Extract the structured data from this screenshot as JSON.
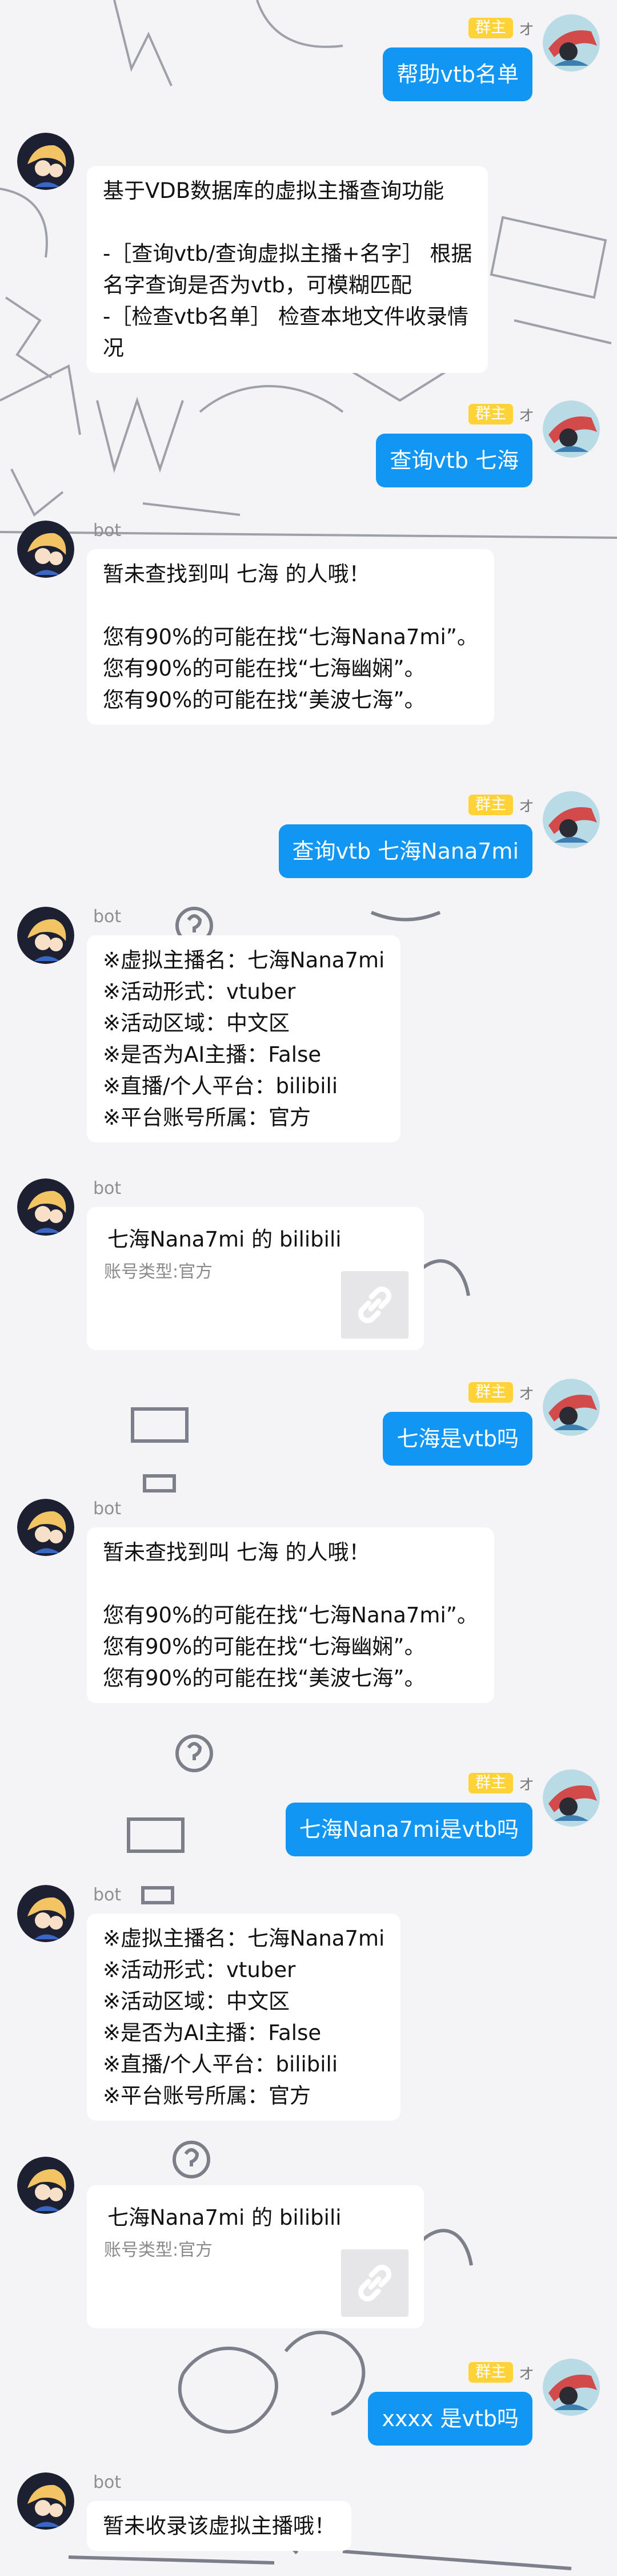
{
  "roles": {
    "owner_badge": "群主",
    "user_name": "オ"
  },
  "colors": {
    "user_bubble": "#1296f4",
    "badge": "#ffd238",
    "bot_bubble": "#ffffff"
  },
  "bot": {
    "name": "bot"
  },
  "messages": {
    "m1": {
      "text": "帮助vtb名单"
    },
    "m2": {
      "text": "基于VDB数据库的虚拟主播查询功能\n\n-［查询vtb/查询虚拟主播+名字］ 根据\n名字查询是否为vtb，可模糊匹配\n-［检查vtb名单］ 检查本地文件收录情\n况"
    },
    "m3": {
      "text": "查询vtb 七海"
    },
    "m4": {
      "text": "暂未查找到叫 七海 的人哦！\n\n您有90%的可能在找“七海Nana7mi”。\n您有90%的可能在找“七海幽娴”。\n您有90%的可能在找“美波七海”。"
    },
    "m5": {
      "text": "查询vtb 七海Nana7mi"
    },
    "m6": {
      "text": "※虚拟主播名：七海Nana7mi\n※活动形式：vtuber\n※活动区域：中文区\n※是否为AI主播：False\n※直播/个人平台：bilibili\n※平台账号所属：官方"
    },
    "m7": {
      "title": "七海Nana7mi 的 bilibili",
      "subtitle": "账号类型:官方",
      "icon": "link-icon"
    },
    "m8": {
      "text": "七海是vtb吗"
    },
    "m9": {
      "text": "暂未查找到叫 七海 的人哦！\n\n您有90%的可能在找“七海Nana7mi”。\n您有90%的可能在找“七海幽娴”。\n您有90%的可能在找“美波七海”。"
    },
    "m10": {
      "text": "七海Nana7mi是vtb吗"
    },
    "m11": {
      "text": "※虚拟主播名：七海Nana7mi\n※活动形式：vtuber\n※活动区域：中文区\n※是否为AI主播：False\n※直播/个人平台：bilibili\n※平台账号所属：官方"
    },
    "m12": {
      "title": "七海Nana7mi 的 bilibili",
      "subtitle": "账号类型:官方",
      "icon": "link-icon"
    },
    "m13": {
      "text": "xxxx 是vtb吗"
    },
    "m14": {
      "text": "暂未收录该虚拟主播哦！"
    }
  }
}
